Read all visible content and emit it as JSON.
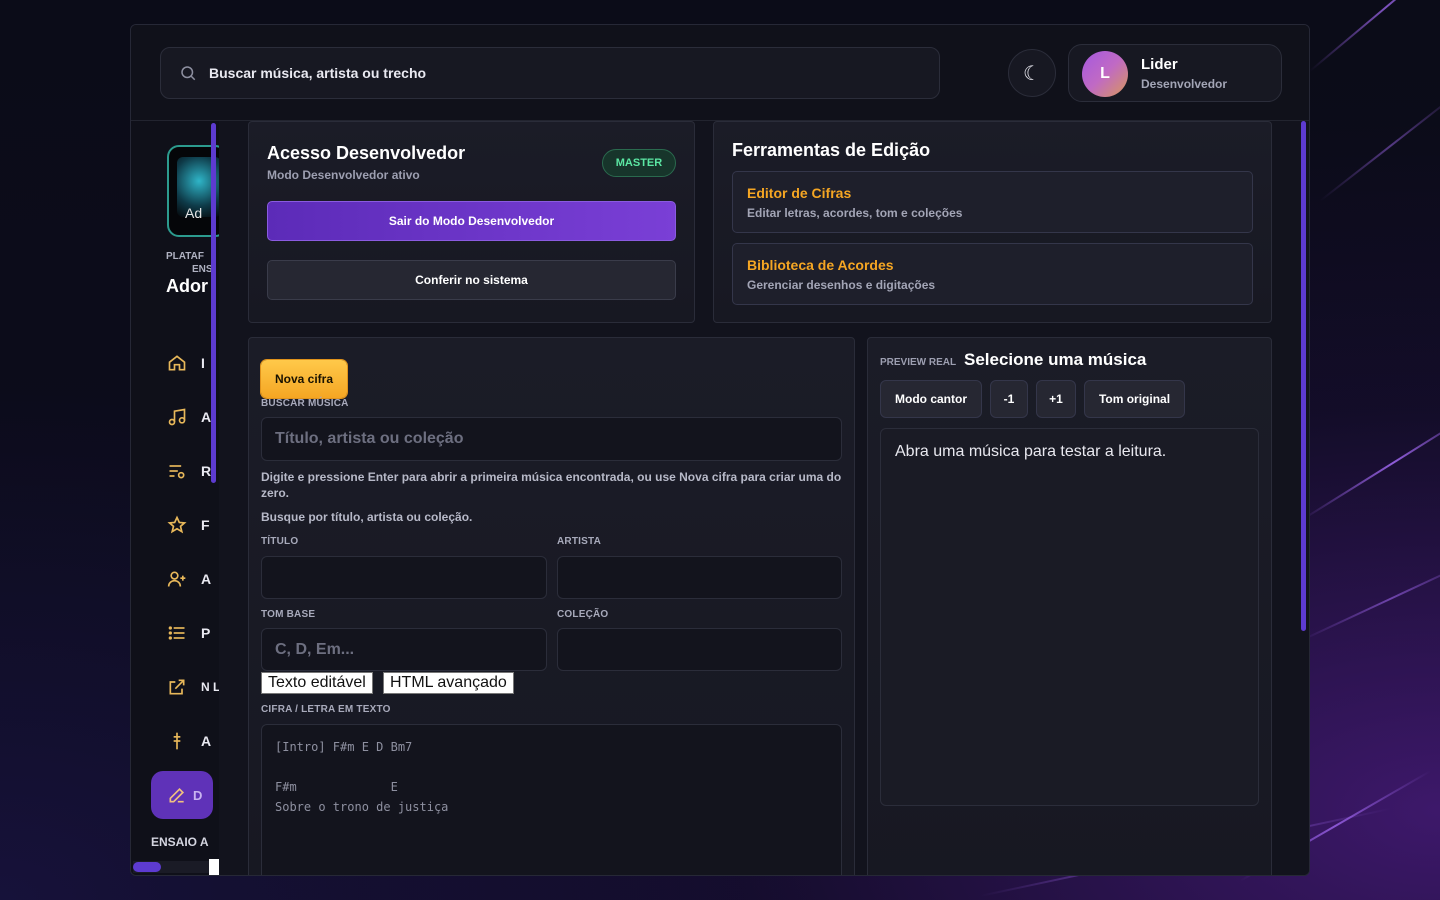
{
  "header": {
    "search_text": "Buscar música, artista ou trecho",
    "theme_icon": "moon-icon",
    "user_initial": "L",
    "user_name": "Lider",
    "user_role": "Desenvolvedor"
  },
  "sidebar": {
    "logo_text": "Ad",
    "platform_line1": "PLATAF",
    "platform_line2": "ENS",
    "brand": "Ador",
    "items": [
      {
        "icon": "home-icon",
        "label": "I"
      },
      {
        "icon": "music-icon",
        "label": "A"
      },
      {
        "icon": "playlist-icon",
        "label": "R"
      },
      {
        "icon": "star-icon",
        "label": "F"
      },
      {
        "icon": "add-user-icon",
        "label": "A"
      },
      {
        "icon": "list-icon",
        "label": "P"
      },
      {
        "icon": "external-link-icon",
        "label": "N L"
      },
      {
        "icon": "chord-icon",
        "label": "A"
      }
    ],
    "active_item": {
      "icon": "pencil-icon",
      "label": "D"
    },
    "section_label": "ENSAIO A"
  },
  "dev_access": {
    "title": "Acesso Desenvolvedor",
    "subtitle": "Modo Desenvolvedor ativo",
    "badge": "MASTER",
    "exit_button": "Sair do Modo Desenvolvedor",
    "check_button": "Conferir no sistema"
  },
  "tools": {
    "title": "Ferramentas de Edição",
    "items": [
      {
        "title": "Editor de Cifras",
        "desc": "Editar letras, acordes, tom e coleções"
      },
      {
        "title": "Biblioteca de Acordes",
        "desc": "Gerenciar desenhos e digitações"
      }
    ]
  },
  "editor": {
    "new_button": "Nova cifra",
    "search_label": "BUSCAR MÚSICA",
    "search_placeholder": "Título, artista ou coleção",
    "help1": "Digite e pressione Enter para abrir a primeira música encontrada, ou use Nova cifra para criar uma do zero.",
    "help2": "Busque por título, artista ou coleção.",
    "title_label": "TÍTULO",
    "artist_label": "ARTISTA",
    "key_label": "TOM BASE",
    "key_placeholder": "C, D, Em...",
    "collection_label": "COLEÇÃO",
    "tab_text": "Texto editável",
    "tab_html": "HTML avançado",
    "text_label": "CIFRA / LETRA EM TEXTO",
    "text_value": "[Intro] F#m E D Bm7\n\nF#m             E\nSobre o trono de justiça"
  },
  "preview": {
    "label": "PREVIEW REAL",
    "title": "Selecione uma música",
    "btn_singer": "Modo cantor",
    "btn_minus": "-1",
    "btn_plus": "+1",
    "btn_original": "Tom original",
    "body": "Abra uma música para testar a leitura."
  }
}
